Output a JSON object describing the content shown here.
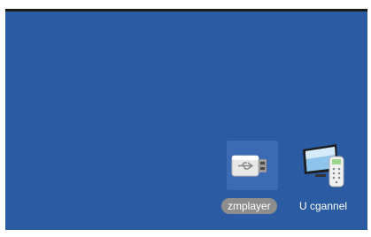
{
  "desktop": {
    "background_color": "#2a5ba3",
    "apps": [
      {
        "label": "zmplayer",
        "icon": "usb-drive-icon",
        "selected": true
      },
      {
        "label": "U cgannel",
        "icon": "tv-remote-icon",
        "selected": false
      }
    ]
  }
}
